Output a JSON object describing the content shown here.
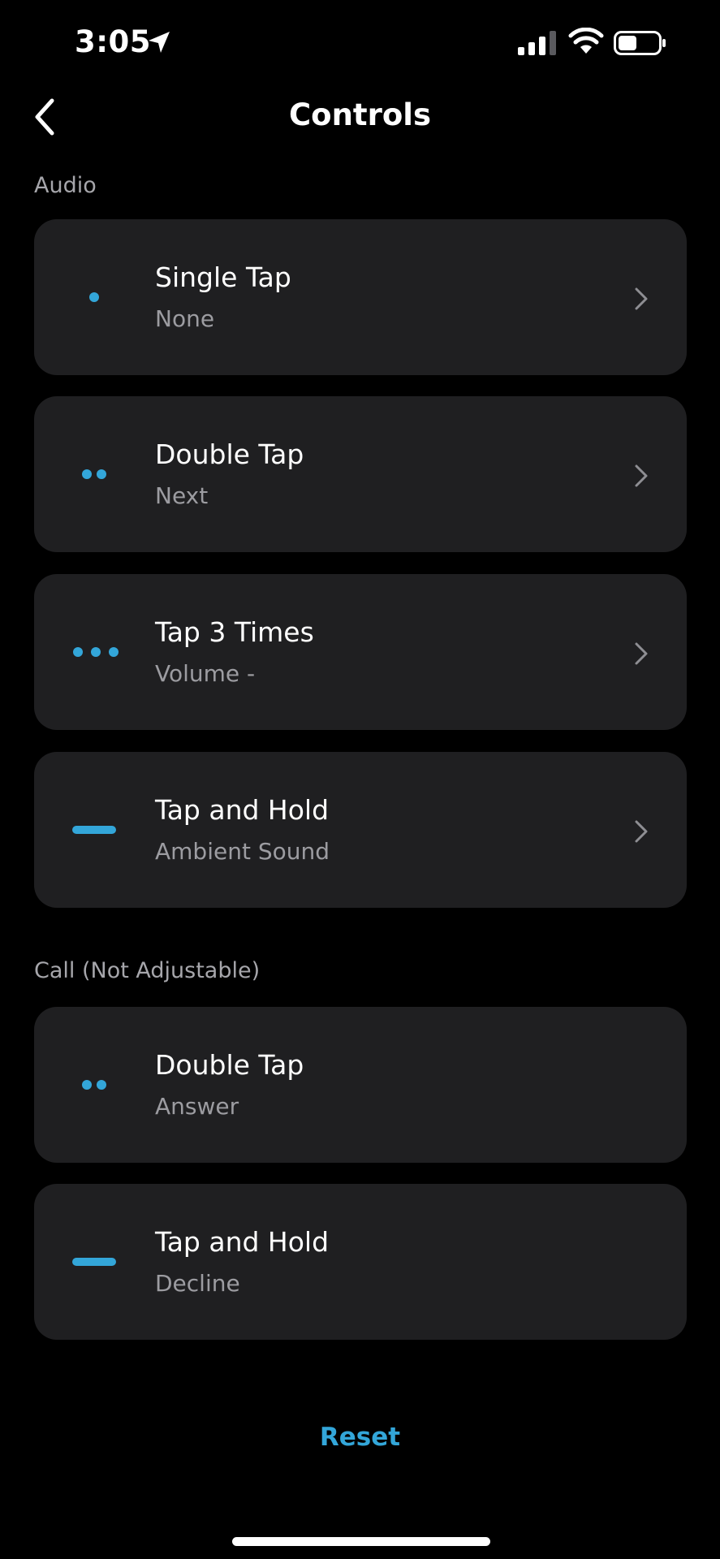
{
  "status_bar": {
    "time": "3:05"
  },
  "nav": {
    "title": "Controls"
  },
  "sections": [
    {
      "header": "Audio",
      "items": [
        {
          "title": "Single Tap",
          "value": "None",
          "indicator": "single-dot",
          "adjustable": true
        },
        {
          "title": "Double Tap",
          "value": "Next",
          "indicator": "double-dot",
          "adjustable": true
        },
        {
          "title": "Tap 3 Times",
          "value": "Volume -",
          "indicator": "triple-dot",
          "adjustable": true
        },
        {
          "title": "Tap and Hold",
          "value": "Ambient Sound",
          "indicator": "dash",
          "adjustable": true
        }
      ]
    },
    {
      "header": "Call (Not Adjustable)",
      "items": [
        {
          "title": "Double Tap",
          "value": "Answer",
          "indicator": "double-dot",
          "adjustable": false
        },
        {
          "title": "Tap and Hold",
          "value": "Decline",
          "indicator": "dash",
          "adjustable": false
        }
      ]
    }
  ],
  "reset_label": "Reset",
  "colors": {
    "background": "#000000",
    "card": "#1f1f21",
    "accent": "#33a6d9",
    "secondary_text": "#9c9ca1"
  }
}
